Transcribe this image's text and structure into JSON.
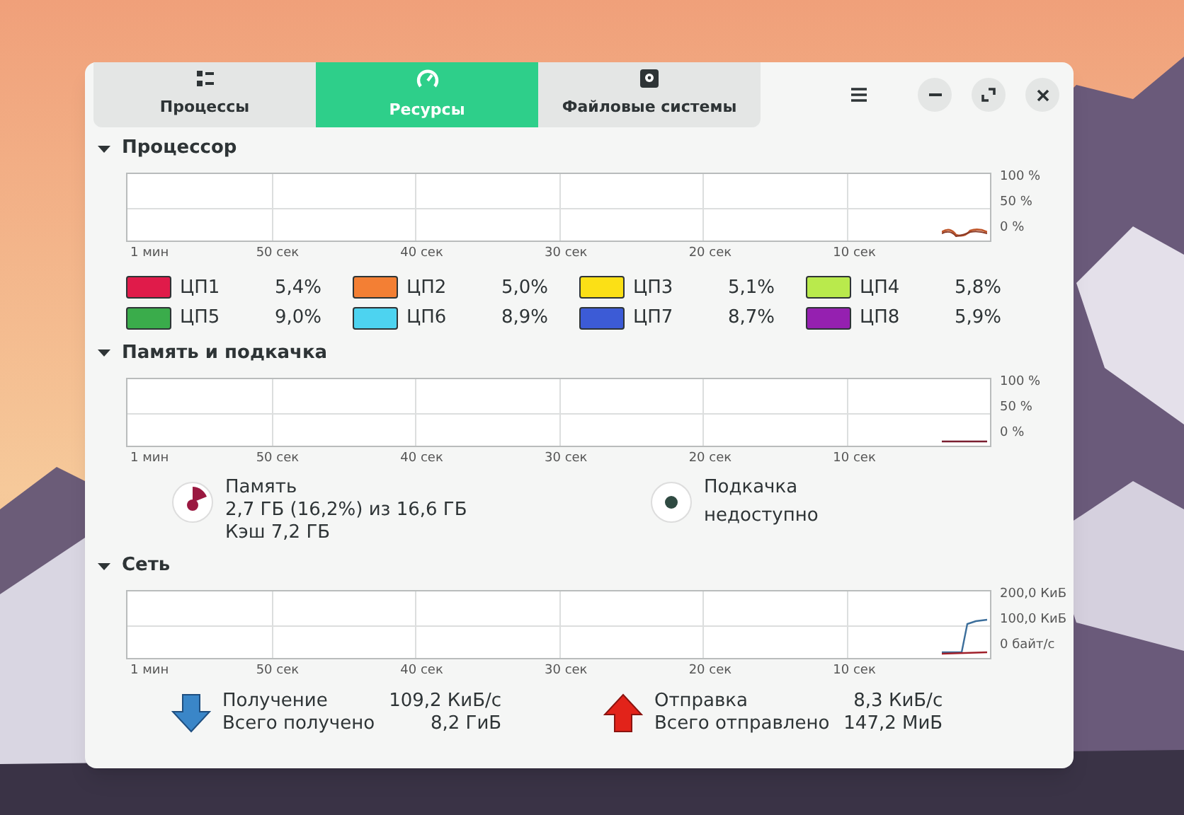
{
  "tabs": [
    {
      "label": "Процессы",
      "kind": "list",
      "selected": false
    },
    {
      "label": "Ресурсы",
      "kind": "gauge",
      "selected": true
    },
    {
      "label": "Файловые системы",
      "kind": "disk",
      "selected": false
    }
  ],
  "sections": [
    {
      "title": "Процессор",
      "kind": "cpu",
      "expanded": true,
      "graph": {
        "y_labels": [
          "100 %",
          "50 %",
          "0 %"
        ],
        "x_labels": [
          "1 мин",
          "50 сек",
          "40 сек",
          "30 сек",
          "20 сек",
          "10 сек"
        ]
      },
      "cpus": [
        {
          "name": "ЦП1",
          "value": "5,4%",
          "color": "#e01b4a"
        },
        {
          "name": "ЦП2",
          "value": "5,0%",
          "color": "#f37f34"
        },
        {
          "name": "ЦП3",
          "value": "5,1%",
          "color": "#fbe016"
        },
        {
          "name": "ЦП4",
          "value": "5,8%",
          "color": "#b9ea4c"
        },
        {
          "name": "ЦП5",
          "value": "9,0%",
          "color": "#3aac4b"
        },
        {
          "name": "ЦП6",
          "value": "8,9%",
          "color": "#4dd3f0"
        },
        {
          "name": "ЦП7",
          "value": "8,7%",
          "color": "#3c5bd6"
        },
        {
          "name": "ЦП8",
          "value": "5,9%",
          "color": "#9520b0"
        }
      ]
    },
    {
      "title": "Память и подкачка",
      "kind": "memory",
      "expanded": true,
      "graph": {
        "y_labels": [
          "100 %",
          "50 %",
          "0 %"
        ],
        "x_labels": [
          "1 мин",
          "50 сек",
          "40 сек",
          "30 сек",
          "20 сек",
          "10 сек"
        ]
      },
      "memory": {
        "label": "Память",
        "usage": "2,7 ГБ (16,2%) из 16,6 ГБ",
        "cache": "Кэш 7,2 ГБ"
      },
      "swap": {
        "label": "Подкачка",
        "status": "недоступно"
      }
    },
    {
      "title": "Сеть",
      "kind": "network",
      "expanded": true,
      "graph": {
        "y_labels": [
          "200,0 КиБ",
          "100,0 КиБ",
          "0 байт/с"
        ],
        "x_labels": [
          "1 мин",
          "50 сек",
          "40 сек",
          "30 сек",
          "20 сек",
          "10 сек"
        ]
      },
      "receive": {
        "label": "Получение",
        "rate": "109,2 КиБ/с",
        "total_label": "Всего получено",
        "total": "8,2 ГиБ"
      },
      "send": {
        "label": "Отправка",
        "rate": "8,3 КиБ/с",
        "total_label": "Всего отправлено",
        "total": "147,2 МиБ"
      }
    }
  ]
}
